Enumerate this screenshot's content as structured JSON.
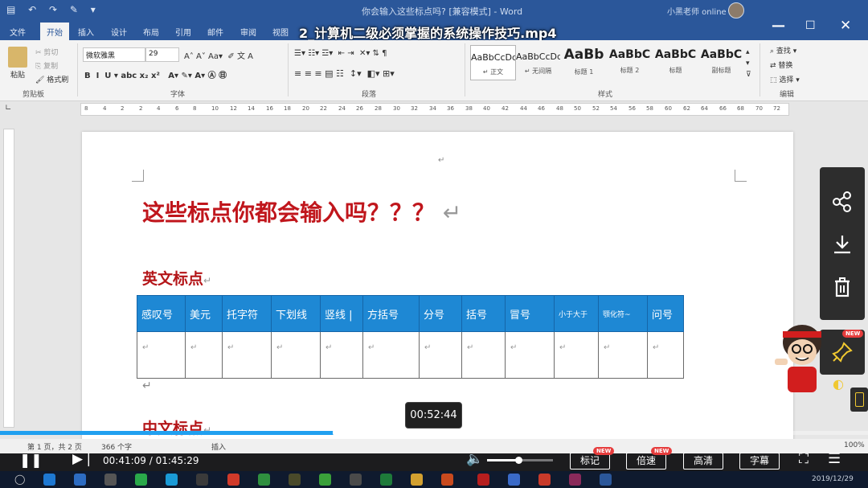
{
  "word": {
    "doc_title": "你会输入这些标点吗? [兼容模式] - Word",
    "user_name": "小黑老师 online",
    "tabs": [
      "文件",
      "开始",
      "插入",
      "设计",
      "布局",
      "引用",
      "邮件",
      "审阅",
      "视图"
    ],
    "active_tab_index": 1,
    "ribbon": {
      "clipboard": {
        "paste": "粘贴",
        "cut": "剪切",
        "copy": "复制",
        "format_painter": "格式刷",
        "label": "剪贴板"
      },
      "font": {
        "name": "微软雅黑",
        "size": "29",
        "label": "字体"
      },
      "paragraph": {
        "label": "段落"
      },
      "styles": {
        "label": "样式",
        "items": [
          {
            "sample": "AaBbCcDd",
            "name": "↵ 正文"
          },
          {
            "sample": "AaBbCcDd",
            "name": "↵ 无间隔"
          },
          {
            "sample": "AaBb",
            "name": "标题 1"
          },
          {
            "sample": "AaBbC",
            "name": "标题 2"
          },
          {
            "sample": "AaBbC",
            "name": "标题"
          },
          {
            "sample": "AaBbC",
            "name": "副标题"
          }
        ]
      },
      "editing": {
        "find": "查找",
        "replace": "替换",
        "select": "选择",
        "label": "编辑"
      }
    },
    "ruler_ticks": [
      "8",
      "4",
      "2",
      "2",
      "4",
      "6",
      "8",
      "10",
      "12",
      "14",
      "16",
      "18",
      "20",
      "22",
      "24",
      "26",
      "28",
      "30",
      "32",
      "34",
      "36",
      "38",
      "40",
      "42",
      "44",
      "46",
      "48",
      "50",
      "52",
      "54",
      "56",
      "58",
      "60",
      "62",
      "64",
      "66",
      "68",
      "70",
      "72"
    ],
    "status": {
      "page": "第 1 页，共 2 页",
      "words": "366 个字",
      "insert": "插入",
      "zoom": "100%"
    }
  },
  "document": {
    "heading": "这些标点你都会输入吗？？？",
    "section_en": "英文标点",
    "section_zh": "中文标点",
    "para_mark": "↵",
    "table_headers": [
      "感叹号",
      "美元",
      "托字符",
      "下划线",
      "竖线 |",
      "方括号",
      "分号",
      "括号",
      "冒号",
      "小于大于",
      "颚化符~",
      "问号"
    ],
    "table_row": [
      "↵",
      "↵",
      "↵",
      "↵",
      "↵",
      "↵",
      "↵",
      "↵",
      "↵",
      "↵",
      "↵",
      "↵"
    ]
  },
  "player": {
    "video_title": "2_计算机二级必须掌握的系统操作技巧.mp4",
    "current_time": "00:41:09",
    "total_time": "01:45:29",
    "time_separator": " / ",
    "hover_time": "00:52:44",
    "progress": 0.39,
    "volume": 0.47,
    "buttons": {
      "mark": "标记",
      "speed": "倍速",
      "quality": "高清",
      "subtitle": "字幕"
    },
    "new_badge": "NEW",
    "accent_color": "#20a0f0"
  },
  "side_panel": {
    "icons": [
      "share-icon",
      "download-icon",
      "trash-icon"
    ],
    "pin_badge": "NEW"
  },
  "taskbar": {
    "date": "2019/12/29"
  }
}
